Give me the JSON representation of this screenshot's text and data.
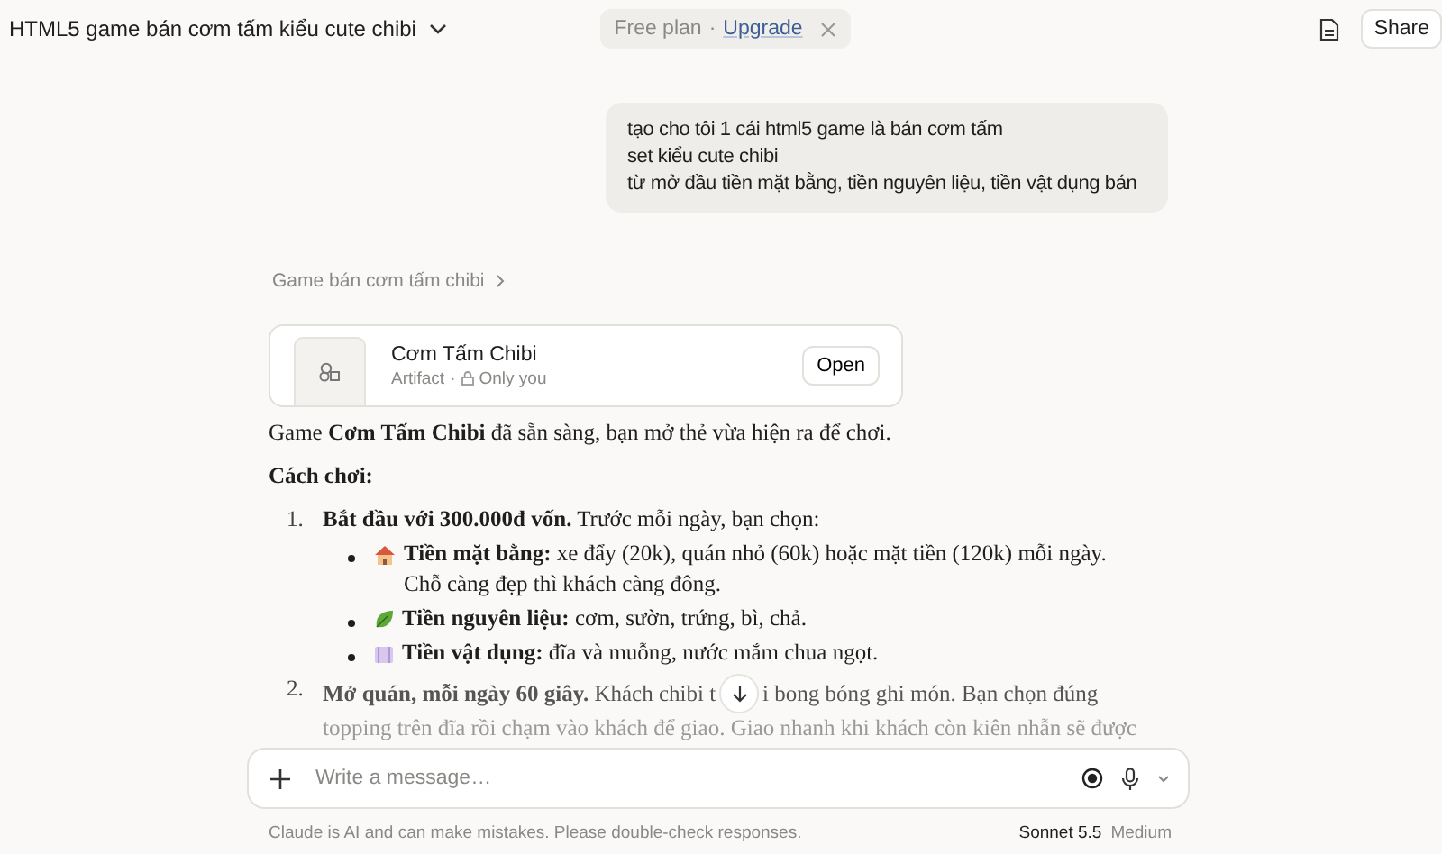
{
  "header": {
    "title": "HTML5 game bán cơm tấm kiểu cute chibi",
    "plan": {
      "label": "Free plan",
      "separator": "·",
      "link": "Upgrade"
    },
    "share": "Share"
  },
  "user_message": [
    "tạo cho tôi 1 cái html5 game là bán cơm tấm",
    "set kiểu cute chibi",
    "từ mở đầu tiền mặt bằng, tiền nguyên liệu, tiền vật dụng bán"
  ],
  "breadcrumb": "Game bán cơm tấm chibi",
  "artifact": {
    "title": "Cơm Tấm Chibi",
    "type": "Artifact",
    "separator": "·",
    "visibility": "Only you",
    "button": "Open"
  },
  "response": {
    "intro": "Game **Cơm Tấm Chibi** đã sẵn sàng, bạn mở thẻ vừa hiện ra để chơi.",
    "heading": "Cách chơi:",
    "steps": [
      {
        "number": "1.",
        "text": "**Bắt đầu với 300.000đ vốn.** Trước mỗi ngày, bạn chọn:",
        "bullets": [
          {
            "text": "**Tiền mặt bằng:** xe đẩy (20k), quán nhỏ (60k) hoặc mặt tiền (120k) mỗi ngày. Chỗ càng đẹp thì khách càng đông."
          },
          {
            "text": "**Tiền nguyên liệu:** cơm, sườn, trứng, bì, chả."
          },
          {
            "text": "**Tiền vật dụng:** đĩa và muỗng, nước mắm chua ngọt."
          }
        ]
      },
      {
        "number": "2.",
        "text": "**Mở quán, mỗi ngày 60 giây.** Khách chibi t",
        "text_after_button": "i bong bóng ghi món. Bạn chọn đúng",
        "next_line": "topping trên đĩa rồi chạm vào khách để giao. Giao nhanh khi khách còn kiên nhẫn sẽ được"
      }
    ]
  },
  "composer": {
    "placeholder": "Write a message…"
  },
  "footer": {
    "disclaimer": "Claude is AI and can make mistakes. Please double-check responses.",
    "model": "Sonnet 5.5",
    "effort": "Medium"
  }
}
